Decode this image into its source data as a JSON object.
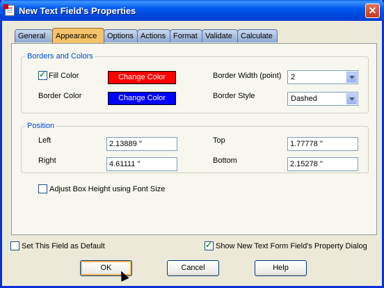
{
  "title": "New Text Field's Properties",
  "tabs": [
    "General",
    "Appearance",
    "Options",
    "Actions",
    "Format",
    "Validate",
    "Calculate"
  ],
  "active_tab": "Appearance",
  "borders": {
    "group_title": "Borders and Colors",
    "fill_color_label": "Fill Color",
    "fill_color_checked": true,
    "fill_color_button": "Change Color",
    "fill_color_value": "#ff0000",
    "border_color_label": "Border Color",
    "border_color_button": "Change Color",
    "border_color_value": "#0000ff",
    "border_width_label": "Border Width (point)",
    "border_width_value": "2",
    "border_style_label": "Border Style",
    "border_style_value": "Dashed"
  },
  "position": {
    "group_title": "Position",
    "left_label": "Left",
    "left_value": "2.13889 ''",
    "top_label": "Top",
    "top_value": "1.77778 ''",
    "right_label": "Right",
    "right_value": "4.61111 ''",
    "bottom_label": "Bottom",
    "bottom_value": "2.15278 ''"
  },
  "adjust_height_label": "Adjust Box Height using Font Size",
  "adjust_height_checked": false,
  "default_label": "Set This Field as Default",
  "default_checked": false,
  "show_dialog_label": "Show New Text Form Field's Property Dialog",
  "show_dialog_checked": true,
  "buttons": {
    "ok": "OK",
    "cancel": "Cancel",
    "help": "Help"
  },
  "close_glyph": "✕"
}
